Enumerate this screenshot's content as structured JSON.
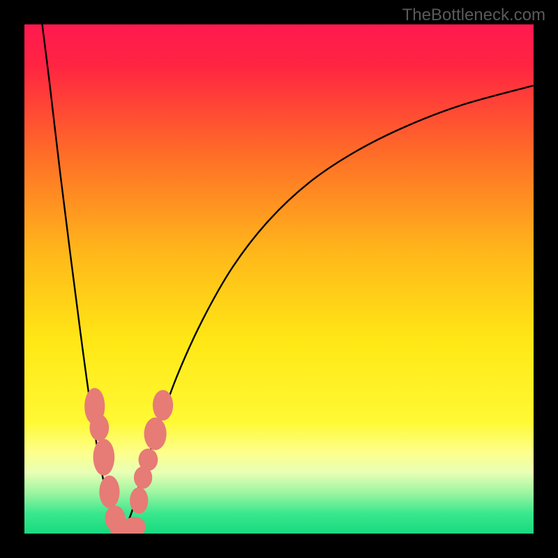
{
  "watermark": "TheBottleneck.com",
  "chart_data": {
    "type": "line",
    "title": "",
    "xlabel": "",
    "ylabel": "",
    "xlim": [
      0,
      100
    ],
    "ylim": [
      0,
      100
    ],
    "gradient_stops": [
      {
        "pos": 0,
        "color": "#ff1a4f"
      },
      {
        "pos": 8,
        "color": "#ff2442"
      },
      {
        "pos": 25,
        "color": "#ff6b28"
      },
      {
        "pos": 45,
        "color": "#ffb81a"
      },
      {
        "pos": 62,
        "color": "#ffe715"
      },
      {
        "pos": 78,
        "color": "#fff934"
      },
      {
        "pos": 84,
        "color": "#fdff8a"
      },
      {
        "pos": 88,
        "color": "#e8ffb5"
      },
      {
        "pos": 92,
        "color": "#9cf5a0"
      },
      {
        "pos": 96,
        "color": "#3ae88e"
      },
      {
        "pos": 100,
        "color": "#18d97f"
      }
    ],
    "series": [
      {
        "name": "left-branch",
        "x": [
          3.5,
          5,
          7,
          9,
          11,
          13,
          15,
          16.5,
          17.5,
          18.5,
          19.2
        ],
        "y": [
          100,
          88,
          71,
          55,
          39.5,
          25,
          13,
          6.3,
          2.8,
          0.7,
          0
        ]
      },
      {
        "name": "right-branch",
        "x": [
          19.2,
          21,
          23,
          26,
          30,
          35,
          41,
          48,
          56,
          65,
          75,
          86,
          100
        ],
        "y": [
          0,
          4,
          11,
          20,
          31,
          42,
          52.5,
          61.5,
          69,
          75,
          80,
          84.2,
          88
        ]
      }
    ],
    "markers": {
      "color": "#e77b76",
      "points": [
        {
          "x": 13.8,
          "y": 25,
          "rx": 2,
          "ry": 3.6
        },
        {
          "x": 14.7,
          "y": 20.8,
          "rx": 1.9,
          "ry": 2.6
        },
        {
          "x": 15.6,
          "y": 15,
          "rx": 2.1,
          "ry": 3.6
        },
        {
          "x": 16.7,
          "y": 8.2,
          "rx": 2.0,
          "ry": 3.2
        },
        {
          "x": 17.8,
          "y": 3.0,
          "rx": 2.0,
          "ry": 2.5
        },
        {
          "x": 19.4,
          "y": 0.9,
          "rx": 2.6,
          "ry": 2.1
        },
        {
          "x": 21.6,
          "y": 1.3,
          "rx": 2.2,
          "ry": 2.0
        },
        {
          "x": 22.5,
          "y": 6.5,
          "rx": 1.8,
          "ry": 2.6
        },
        {
          "x": 23.3,
          "y": 11,
          "rx": 1.8,
          "ry": 2.2
        },
        {
          "x": 24.3,
          "y": 14.5,
          "rx": 1.9,
          "ry": 2.2
        },
        {
          "x": 25.7,
          "y": 19.6,
          "rx": 2.2,
          "ry": 3.2
        },
        {
          "x": 27.2,
          "y": 25.2,
          "rx": 2.0,
          "ry": 3.0
        }
      ]
    }
  }
}
